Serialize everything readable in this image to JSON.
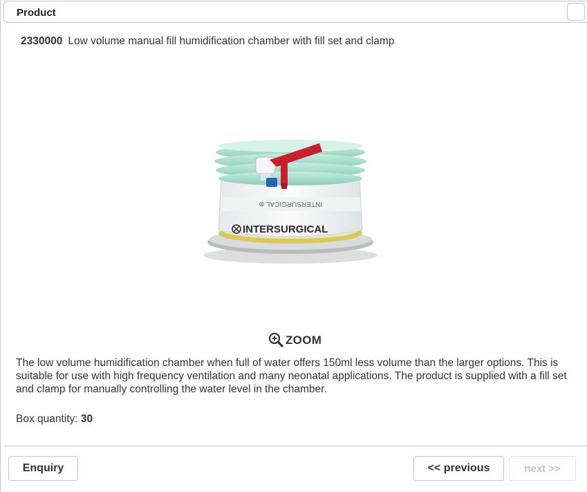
{
  "dialog": {
    "title": "Product"
  },
  "product": {
    "code": "2330000",
    "name": "Low volume manual fill humidification chamber with fill set and clamp",
    "image_brand_text": "INTERSURGICAL",
    "zoom_label": "ZOOM",
    "description": "The low volume humidification chamber when full of water offers 150ml less volume than the larger options. This is suitable for use with high frequency ventilation and many neonatal applications. The product is supplied with a fill set and clamp for manually controlling the water level in the chamber.",
    "box_quantity_label": "Box quantity:",
    "box_quantity_value": "30"
  },
  "footer": {
    "enquiry_label": "Enquiry",
    "previous_label": "<< previous",
    "next_label": "next >>"
  },
  "icons": {
    "zoom": "zoom-in-magnifier-icon",
    "close": "close-box-icon"
  },
  "colors": {
    "border": "#c4c4c4",
    "text": "#333333",
    "disabled_text": "#c4c4c4",
    "tube_green": "#9fd9c6",
    "clamp_red": "#c8202e",
    "seal_yellow": "#d9c95a"
  }
}
